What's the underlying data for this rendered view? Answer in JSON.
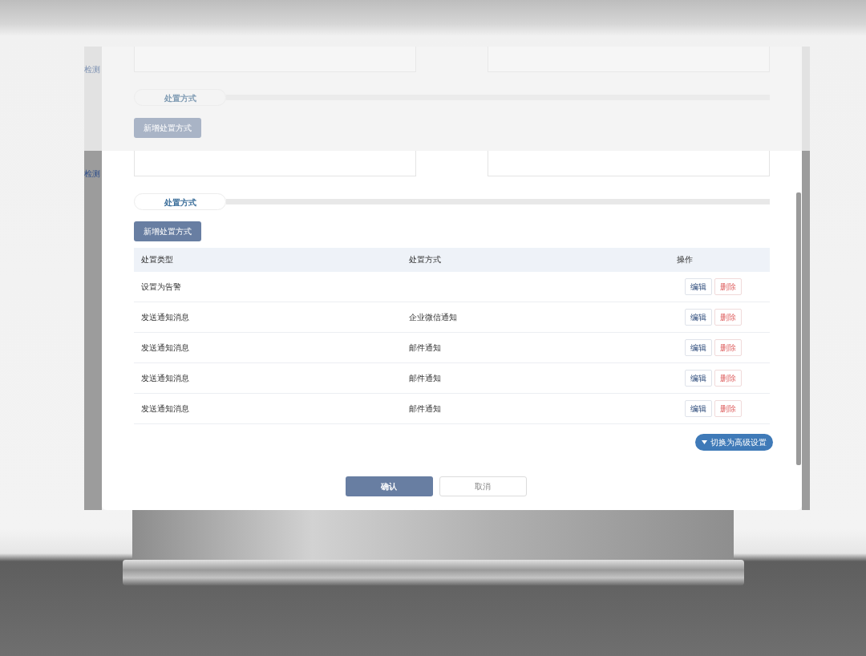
{
  "side_labels": [
    "检测",
    "检测"
  ],
  "ghost": {
    "section_title": "处置方式",
    "add_button": "新增处置方式"
  },
  "section_title": "处置方式",
  "add_button": "新增处置方式",
  "table": {
    "columns": [
      "处置类型",
      "处置方式",
      "操作"
    ],
    "rows": [
      {
        "type": "设置为告警",
        "actions": [
          "编辑",
          "删除"
        ]
      },
      {
        "type": "发送通知消息",
        "method": "企业微信通知",
        "actions": [
          "编辑",
          "删除"
        ]
      },
      {
        "type": "发送通知消息",
        "method": "邮件通知",
        "actions": [
          "编辑",
          "删除"
        ]
      },
      {
        "type": "发送通知消息",
        "method": "邮件通知",
        "actions": [
          "编辑",
          "删除"
        ]
      },
      {
        "type": "发送通知消息",
        "method": "邮件通知",
        "actions": [
          "编辑",
          "删除"
        ]
      }
    ]
  },
  "toggle_button": "切换为高级设置",
  "footer": {
    "confirm": "确认",
    "cancel": "取消"
  }
}
